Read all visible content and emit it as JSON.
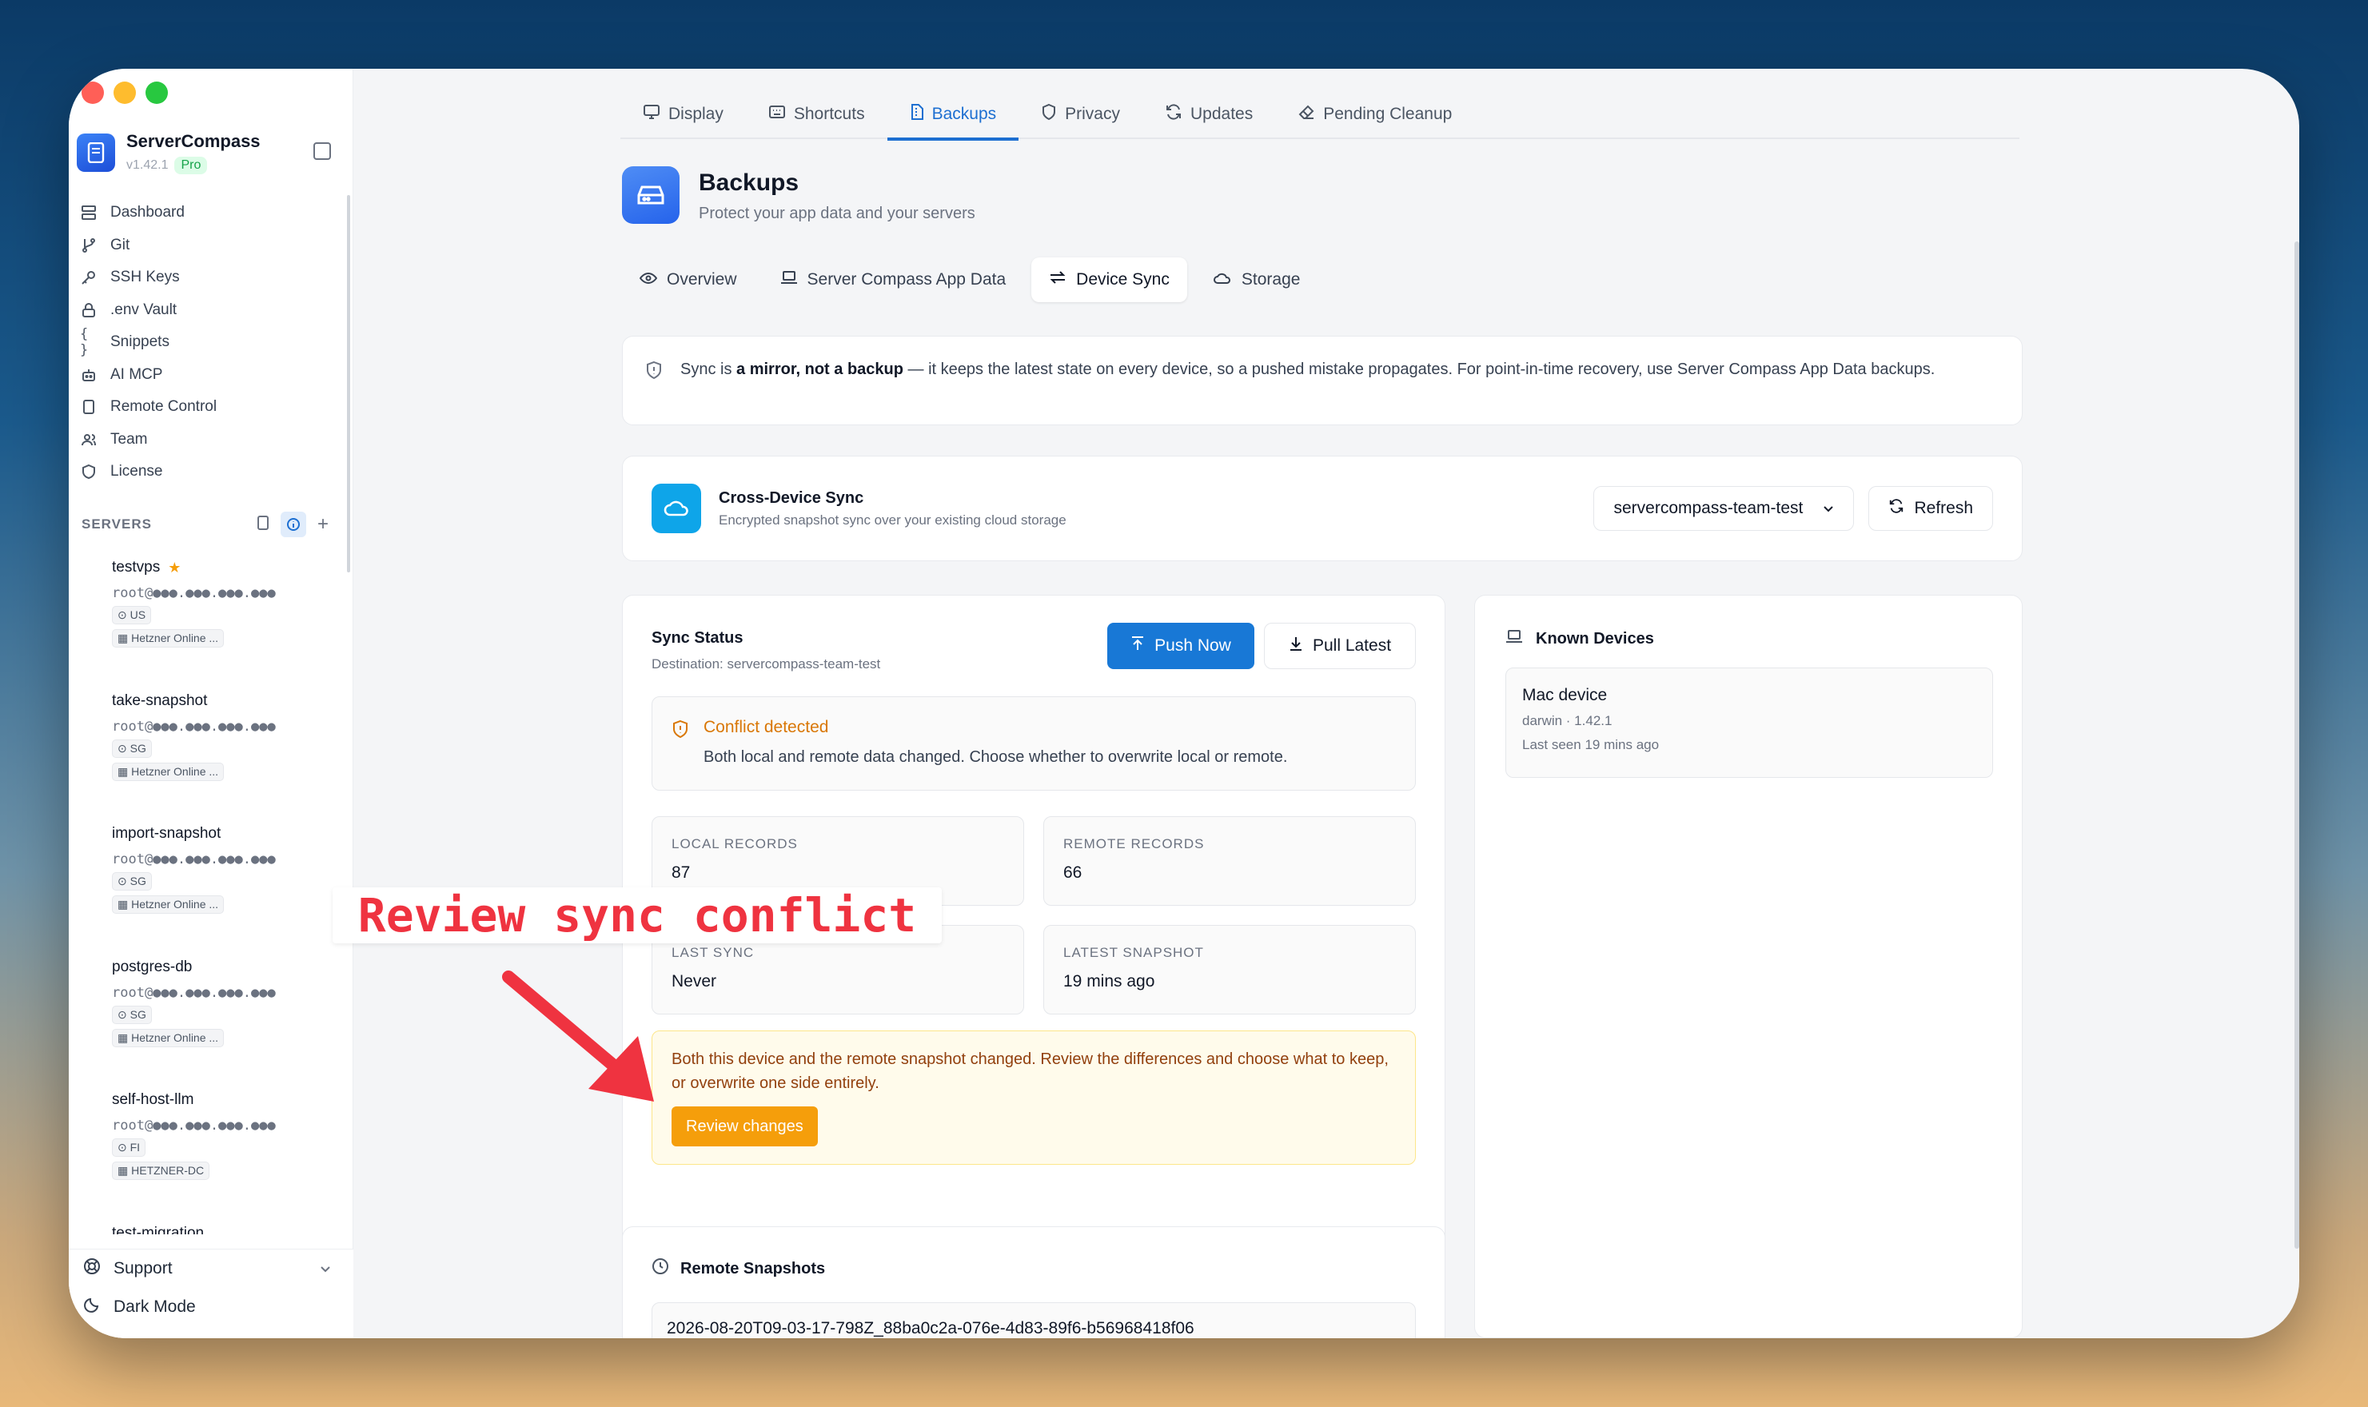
{
  "app": {
    "name": "ServerCompass",
    "version": "v1.42.1",
    "plan": "Pro"
  },
  "sidebar": {
    "nav": [
      {
        "label": "Dashboard",
        "icon": "dashboard-icon"
      },
      {
        "label": "Git",
        "icon": "git-branch-icon"
      },
      {
        "label": "SSH Keys",
        "icon": "key-icon"
      },
      {
        "label": ".env Vault",
        "icon": "lock-icon"
      },
      {
        "label": "Snippets",
        "icon": "braces-icon"
      },
      {
        "label": "AI MCP",
        "icon": "bot-icon"
      },
      {
        "label": "Remote Control",
        "icon": "tablet-icon"
      },
      {
        "label": "Team",
        "icon": "users-icon"
      },
      {
        "label": "License",
        "icon": "shield-icon"
      }
    ],
    "servers_heading": "SERVERS",
    "servers": [
      {
        "name": "testvps",
        "starred": true,
        "host": "root@●●●.●●●.●●●.●●●",
        "region": "US",
        "provider": "Hetzner Online ..."
      },
      {
        "name": "take-snapshot",
        "starred": false,
        "host": "root@●●●.●●●.●●●.●●●",
        "region": "SG",
        "provider": "Hetzner Online ..."
      },
      {
        "name": "import-snapshot",
        "starred": false,
        "host": "root@●●●.●●●.●●●.●●●",
        "region": "SG",
        "provider": "Hetzner Online ..."
      },
      {
        "name": "postgres-db",
        "starred": false,
        "host": "root@●●●.●●●.●●●.●●●",
        "region": "SG",
        "provider": "Hetzner Online ..."
      },
      {
        "name": "self-host-llm",
        "starred": false,
        "host": "root@●●●.●●●.●●●.●●●",
        "region": "FI",
        "provider": "HETZNER-DC"
      },
      {
        "name": "test-migration",
        "starred": false,
        "host": "",
        "region": "",
        "provider": ""
      }
    ],
    "footer": {
      "support": "Support",
      "dark_mode": "Dark Mode"
    }
  },
  "tabs": [
    {
      "label": "Display",
      "icon": "monitor-icon",
      "active": false
    },
    {
      "label": "Shortcuts",
      "icon": "keyboard-icon",
      "active": false
    },
    {
      "label": "Backups",
      "icon": "file-archive-icon",
      "active": true
    },
    {
      "label": "Privacy",
      "icon": "shield-icon",
      "active": false
    },
    {
      "label": "Updates",
      "icon": "refresh-icon",
      "active": false
    },
    {
      "label": "Pending Cleanup",
      "icon": "eraser-icon",
      "active": false
    }
  ],
  "page": {
    "title": "Backups",
    "subtitle": "Protect your app data and your servers"
  },
  "subtabs": [
    {
      "label": "Overview",
      "icon": "eye-icon",
      "active": false
    },
    {
      "label": "Server Compass App Data",
      "icon": "laptop-icon",
      "active": false
    },
    {
      "label": "Device Sync",
      "icon": "swap-icon",
      "active": true
    },
    {
      "label": "Storage",
      "icon": "cloud-icon",
      "active": false
    }
  ],
  "notice": {
    "prefix": "Sync is ",
    "bold": "a mirror, not a backup",
    "rest": " — it keeps the latest state on every device, so a pushed mistake propagates. For point-in-time recovery, use Server Compass App Data backups."
  },
  "cross_device": {
    "title": "Cross-Device Sync",
    "subtitle": "Encrypted snapshot sync over your existing cloud storage",
    "selected_target": "servercompass-team-test",
    "refresh_label": "Refresh"
  },
  "sync_status": {
    "title": "Sync Status",
    "destination": "Destination: servercompass-team-test",
    "push_label": "Push Now",
    "pull_label": "Pull Latest",
    "conflict_title": "Conflict detected",
    "conflict_desc": "Both local and remote data changed. Choose whether to overwrite local or remote.",
    "stats": [
      {
        "label": "LOCAL RECORDS",
        "value": "87"
      },
      {
        "label": "REMOTE RECORDS",
        "value": "66"
      },
      {
        "label": "LAST SYNC",
        "value": "Never"
      },
      {
        "label": "LATEST SNAPSHOT",
        "value": "19 mins ago"
      }
    ],
    "warning_text": "Both this device and the remote snapshot changed. Review the differences and choose what to keep, or overwrite one side entirely.",
    "review_label": "Review changes"
  },
  "known_devices": {
    "title": "Known Devices",
    "devices": [
      {
        "name": "Mac device",
        "meta": "darwin · 1.42.1",
        "last_seen": "Last seen 19 mins ago"
      }
    ]
  },
  "remote_snapshots": {
    "title": "Remote Snapshots",
    "items": [
      "2026-08-20T09-03-17-798Z_88ba0c2a-076e-4d83-89f6-b56968418f06"
    ]
  },
  "annotation": {
    "text": "Review sync conflict",
    "color": "#ef3340"
  },
  "colors": {
    "accent": "#1878d6",
    "warning": "#f59e0b",
    "online": "#22c55e"
  }
}
